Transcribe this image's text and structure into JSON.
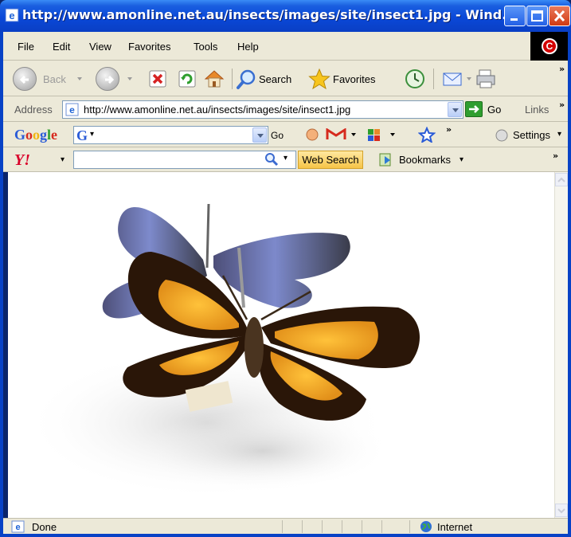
{
  "window": {
    "title": "http://www.amonline.net.au/insects/images/site/insect1.jpg - Wind..."
  },
  "menu": {
    "items": [
      "File",
      "Edit",
      "View",
      "Favorites",
      "Tools",
      "Help"
    ]
  },
  "toolbar": {
    "back_label": "Back",
    "search_label": "Search",
    "favorites_label": "Favorites"
  },
  "address": {
    "label": "Address",
    "url": "http://www.amonline.net.au/insects/images/site/insect1.jpg",
    "go_label": "Go",
    "links_label": "Links"
  },
  "google": {
    "logo": "Google",
    "go_label": "Go",
    "settings_label": "Settings"
  },
  "yahoo": {
    "logo": "Y!",
    "search_value": "",
    "web_search_label": "Web Search",
    "bookmarks_label": "Bookmarks"
  },
  "content": {
    "image_subject": "two mounted butterflies, one orange-black and one blue"
  },
  "status": {
    "text": "Done",
    "zone": "Internet"
  },
  "colors": {
    "titlebar": "#0a48d8",
    "chrome": "#ece9d8",
    "web_search": "#f6c447"
  }
}
